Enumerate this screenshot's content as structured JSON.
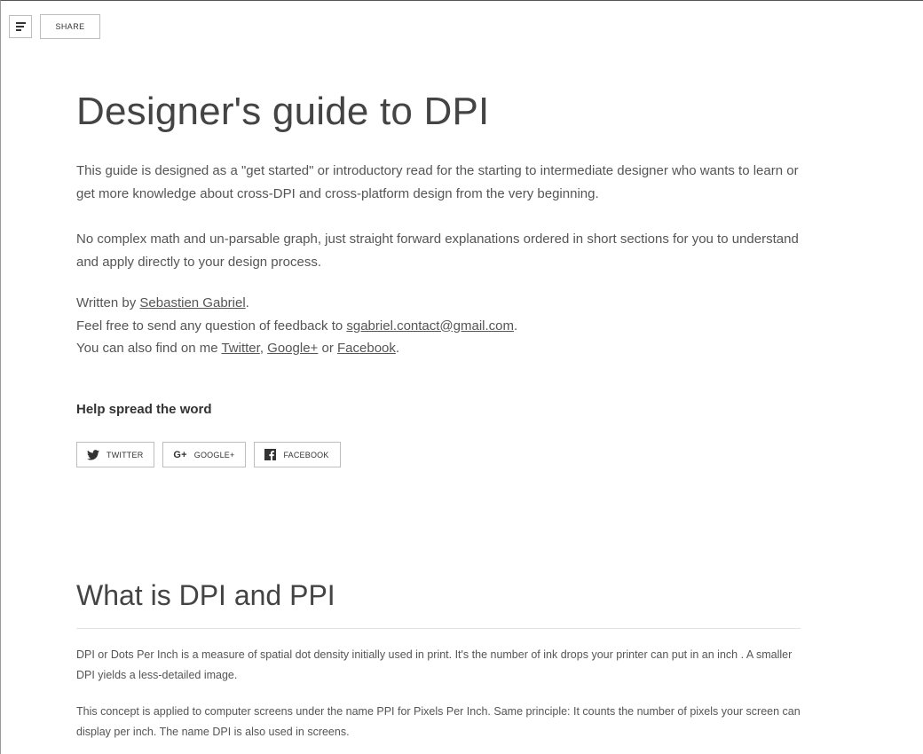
{
  "toolbar": {
    "menu_icon": "menu-icon",
    "share_label": "SHARE"
  },
  "article": {
    "title": "Designer's guide to DPI",
    "intro_1": "This guide is designed as a \"get started\" or introductory read for the starting to intermediate designer who wants to learn or get more knowledge about cross-DPI and cross-platform design from the very beginning.",
    "intro_2": "No complex math and un-parsable graph, just straight forward explanations ordered in short sections for you to understand and apply directly to your design process.",
    "author_prefix": "Written by ",
    "author_name": "Sebastien Gabriel",
    "author_suffix": ".",
    "feedback_prefix": "Feel free to send any question of feedback to ",
    "feedback_email": "sgabriel.contact@gmail.com",
    "feedback_suffix": ".",
    "find_prefix": "You can also find on me ",
    "find_twitter": "Twitter",
    "find_sep1": ", ",
    "find_google": "Google+",
    "find_sep2": " or ",
    "find_facebook": "Facebook",
    "find_suffix": "."
  },
  "spread": {
    "title": "Help spread the word",
    "buttons": [
      {
        "label": "TWITTER",
        "icon": "twitter-icon"
      },
      {
        "label": "GOOGLE+",
        "icon": "google-plus-icon"
      },
      {
        "label": "FACEBOOK",
        "icon": "facebook-icon"
      }
    ]
  },
  "section": {
    "heading": "What is DPI and PPI",
    "para_1": "DPI or Dots Per Inch is a measure of spatial dot density initially used in print. It's the number of ink drops your printer can put in an inch . A smaller DPI yields a less-detailed image.",
    "para_2": "This concept is applied to computer screens under the name PPI for Pixels Per Inch. Same principle: It counts the number of pixels your screen can display per inch. The name DPI is also used in screens."
  },
  "glyphs": {
    "gplus": "G+"
  }
}
